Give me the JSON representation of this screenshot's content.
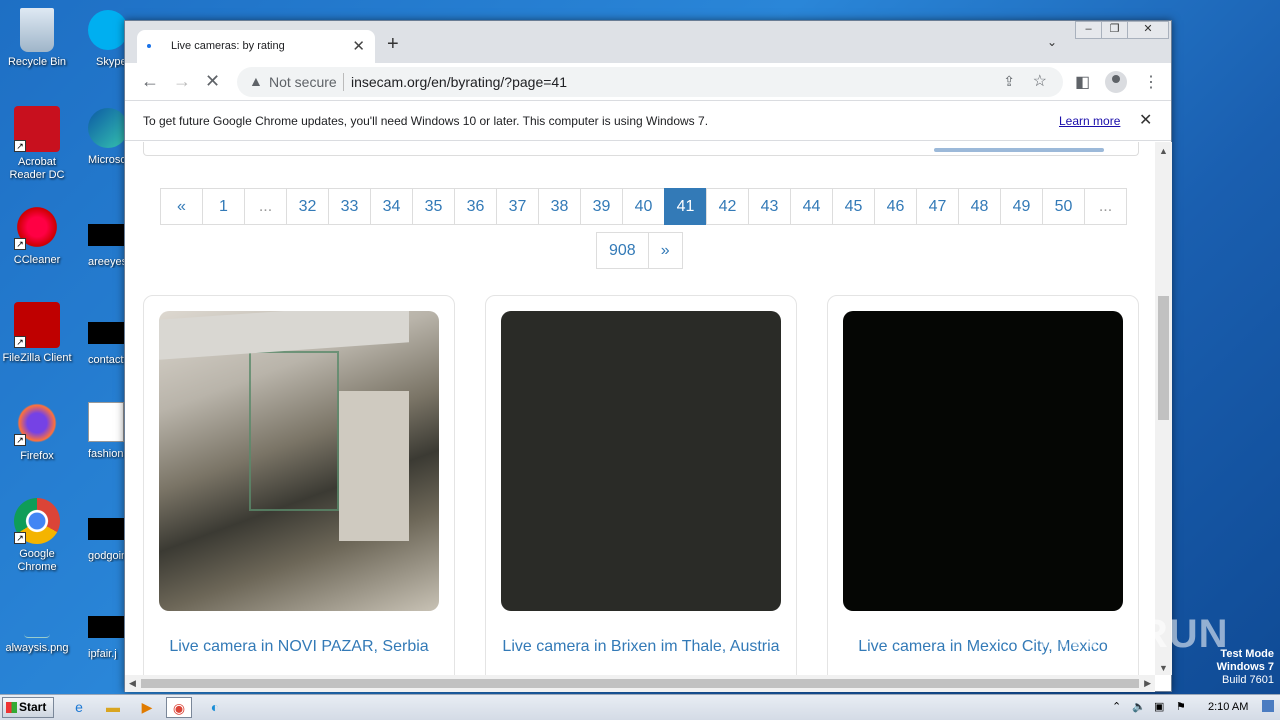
{
  "desktop": {
    "icons": [
      {
        "label": "Recycle Bin"
      },
      {
        "label": "Acrobat Reader DC"
      },
      {
        "label": "CCleaner"
      },
      {
        "label": "FileZilla Client"
      },
      {
        "label": "Firefox"
      },
      {
        "label": "Google Chrome"
      },
      {
        "label": "alwaysis.png"
      }
    ],
    "partial_icons": [
      {
        "label": "Skype"
      },
      {
        "label": "Microsoft"
      },
      {
        "label": "areeyes"
      },
      {
        "label": "contactfri"
      },
      {
        "label": "fashionsy"
      },
      {
        "label": "godgoing"
      },
      {
        "label": "ipfair.j"
      }
    ]
  },
  "browser": {
    "tab_title": "Live cameras: by rating",
    "address": {
      "security_label": "Not secure",
      "url": "insecam.org/en/byrating/?page=41"
    },
    "infobar": {
      "message": "To get future Google Chrome updates, you'll need Windows 10 or later. This computer is using Windows 7.",
      "link": "Learn more"
    }
  },
  "page": {
    "pagination": {
      "prev": "«",
      "pages": [
        "1",
        "...",
        "32",
        "33",
        "34",
        "35",
        "36",
        "37",
        "38",
        "39",
        "40",
        "41",
        "42",
        "43",
        "44",
        "45",
        "46",
        "47",
        "48",
        "49",
        "50",
        "..."
      ],
      "current": "41",
      "last": "908",
      "next": "»"
    },
    "cameras": [
      {
        "caption": "Live camera in NOVI PAZAR, Serbia"
      },
      {
        "caption": "Live camera in Brixen im Thale, Austria"
      },
      {
        "caption": "Live camera in Mexico City, Mexico"
      }
    ]
  },
  "taskbar": {
    "start_label": "Start",
    "clock": "2:10 AM"
  },
  "overlay": {
    "watermark": "ANY RUN",
    "test_mode": [
      "Test Mode",
      "Windows 7",
      "Build 7601"
    ]
  },
  "colors": {
    "link": "#337ab7",
    "active_page_bg": "#337ab7"
  }
}
